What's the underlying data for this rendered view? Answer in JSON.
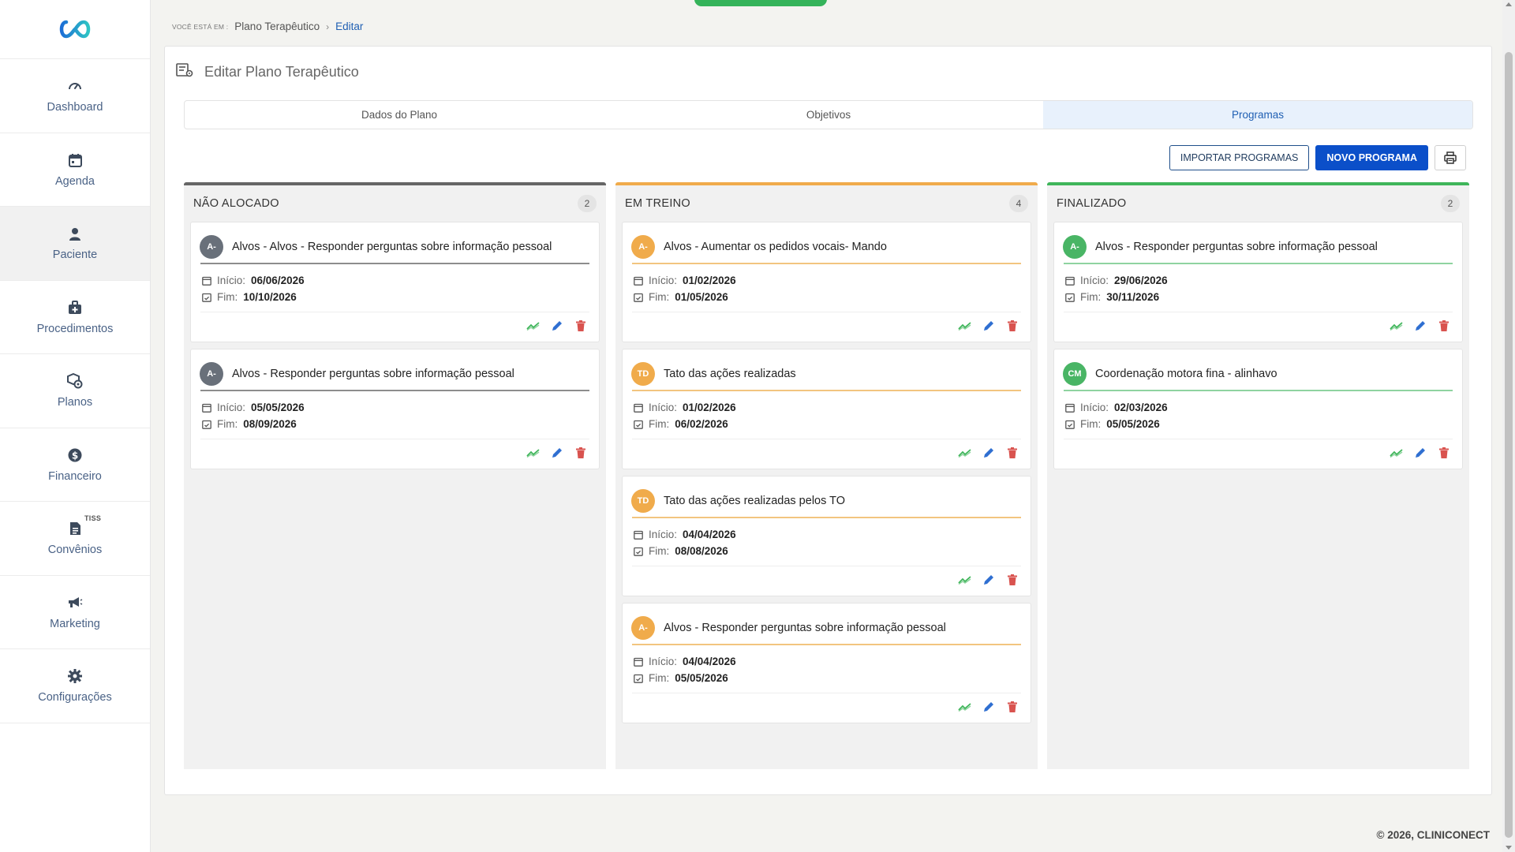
{
  "colors": {
    "accent": "#0b4fc9",
    "link": "#1f5fb3",
    "gray": "#69707a",
    "orange": "#f0ab4b",
    "green": "#3fb55a"
  },
  "sidebar": {
    "items": [
      {
        "label": "Dashboard",
        "icon": "gauge-icon"
      },
      {
        "label": "Agenda",
        "icon": "calendar-icon"
      },
      {
        "label": "Paciente",
        "icon": "user-icon"
      },
      {
        "label": "Procedimentos",
        "icon": "medkit-icon"
      },
      {
        "label": "Planos",
        "icon": "box-gear-icon"
      },
      {
        "label": "Financeiro",
        "icon": "dollar-icon"
      },
      {
        "label": "Convênios",
        "icon": "document-icon",
        "badge": "TISS"
      },
      {
        "label": "Marketing",
        "icon": "megaphone-icon"
      },
      {
        "label": "Configurações",
        "icon": "gear-icon"
      }
    ]
  },
  "breadcrumb": {
    "prefix": "VOCÊ ESTÁ EM :",
    "parent": "Plano Terapêutico",
    "separator": "›",
    "current": "Editar"
  },
  "page": {
    "title": "Editar Plano Terapêutico"
  },
  "tabs": [
    {
      "label": "Dados do Plano"
    },
    {
      "label": "Objetivos"
    },
    {
      "label": "Programas"
    }
  ],
  "toolbar": {
    "import_label": "IMPORTAR PROGRAMAS",
    "new_label": "NOVO PROGRAMA"
  },
  "columns": [
    {
      "title": "NÃO ALOCADO",
      "count": "2",
      "cards": [
        {
          "initials": "A-",
          "title": "Alvos - Alvos - Responder perguntas sobre informação pessoal",
          "start_label": "Início:",
          "start": "06/06/2026",
          "end_label": "Fim:",
          "end": "10/10/2026"
        },
        {
          "initials": "A-",
          "title": "Alvos - Responder perguntas sobre informação pessoal",
          "start_label": "Início:",
          "start": "05/05/2026",
          "end_label": "Fim:",
          "end": "08/09/2026"
        }
      ]
    },
    {
      "title": "EM TREINO",
      "count": "4",
      "cards": [
        {
          "initials": "A-",
          "title": "Alvos - Aumentar os pedidos vocais- Mando",
          "start_label": "Início:",
          "start": "01/02/2026",
          "end_label": "Fim:",
          "end": "01/05/2026"
        },
        {
          "initials": "TD",
          "title": "Tato das ações realizadas",
          "start_label": "Início:",
          "start": "01/02/2026",
          "end_label": "Fim:",
          "end": "06/02/2026"
        },
        {
          "initials": "TD",
          "title": "Tato das ações realizadas pelos TO",
          "start_label": "Início:",
          "start": "04/04/2026",
          "end_label": "Fim:",
          "end": "08/08/2026"
        },
        {
          "initials": "A-",
          "title": "Alvos - Responder perguntas sobre informação pessoal",
          "start_label": "Início:",
          "start": "04/04/2026",
          "end_label": "Fim:",
          "end": "05/05/2026"
        }
      ]
    },
    {
      "title": "FINALIZADO",
      "count": "2",
      "cards": [
        {
          "initials": "A-",
          "title": "Alvos - Responder perguntas sobre informação pessoal",
          "start_label": "Início:",
          "start": "29/06/2026",
          "end_label": "Fim:",
          "end": "30/11/2026"
        },
        {
          "initials": "CM",
          "title": "Coordenação motora fina - alinhavo",
          "start_label": "Início:",
          "start": "02/03/2026",
          "end_label": "Fim:",
          "end": "05/05/2026"
        }
      ]
    }
  ],
  "footer": {
    "text": "© 2026, CLINICONECT"
  }
}
